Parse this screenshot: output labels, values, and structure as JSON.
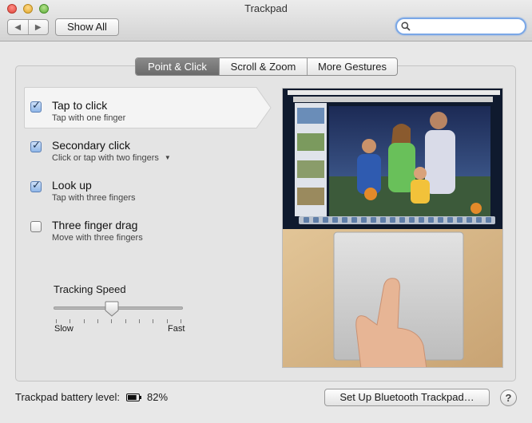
{
  "window": {
    "title": "Trackpad"
  },
  "toolbar": {
    "show_all_label": "Show All",
    "back_icon": "chevron-left-icon",
    "forward_icon": "chevron-right-icon"
  },
  "search": {
    "value": "",
    "placeholder": "",
    "icon": "search-icon"
  },
  "tabs": [
    {
      "label": "Point & Click",
      "active": true
    },
    {
      "label": "Scroll & Zoom",
      "active": false
    },
    {
      "label": "More Gestures",
      "active": false
    }
  ],
  "options": [
    {
      "title": "Tap to click",
      "subtitle": "Tap with one finger",
      "checked": true,
      "selected": true
    },
    {
      "title": "Secondary click",
      "subtitle": "Click or tap with two fingers",
      "checked": true,
      "has_dropdown": true
    },
    {
      "title": "Look up",
      "subtitle": "Tap with three fingers",
      "checked": true
    },
    {
      "title": "Three finger drag",
      "subtitle": "Move with three fingers",
      "checked": false
    }
  ],
  "tracking_speed": {
    "label": "Tracking Speed",
    "min_label": "Slow",
    "max_label": "Fast",
    "value_fraction": 0.45,
    "tick_count": 10
  },
  "footer": {
    "battery_label": "Trackpad battery level:",
    "battery_value": "82%",
    "setup_button": "Set Up Bluetooth Trackpad…",
    "help_label": "?"
  }
}
